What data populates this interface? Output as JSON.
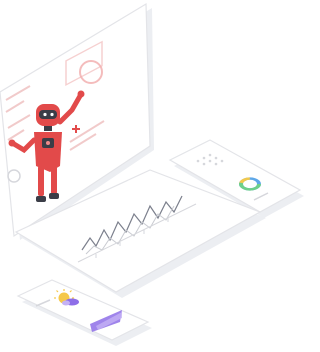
{
  "colors": {
    "background": "#ffffff",
    "device_fill": "#ffffff",
    "device_edge": "#e3e4e8",
    "device_shadow": "#eceef2",
    "ui_lines": "#d6d7dc",
    "robot_red": "#e24a4a",
    "robot_red_light": "#f08a8a",
    "robot_dark": "#3b3d47",
    "robot_gray": "#c9cbd1",
    "chart_line": "#7b7f8c",
    "donut_green": "#6fd08a",
    "donut_yellow": "#f2c94c",
    "donut_blue": "#5fa8e8",
    "bar_purple": "#8e6ee8",
    "bar_purple_light": "#c4b2f5",
    "sun_yellow": "#f5c84a"
  },
  "icons": {
    "robot": "robot-illustration",
    "line_chart": "line-chart-icon",
    "donut_chart": "donut-chart-icon",
    "weather": "weather-icon",
    "area_chart": "area-chart-icon"
  }
}
